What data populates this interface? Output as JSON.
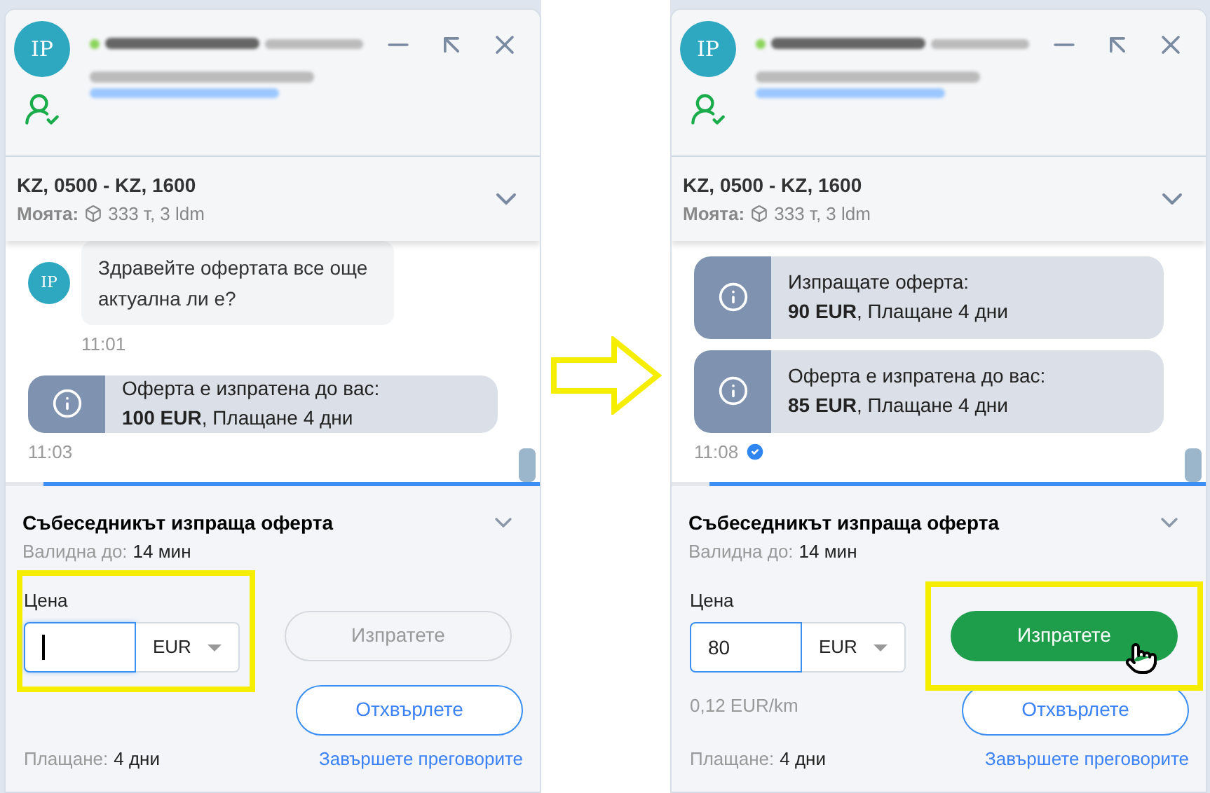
{
  "panels": [
    {
      "avatar": "IP",
      "route": "KZ, 0500 - KZ, 1600",
      "cargo_label": "Моята:",
      "cargo": "333 т, 3 ldm",
      "messages": [
        {
          "kind": "text",
          "avatar": "IP",
          "text": "Здравейте офертата все още актуална ли е?",
          "time": "11:01"
        },
        {
          "kind": "offer",
          "line1": "Оферта е изпратена до вас:",
          "line2": "**100 EUR**, Плащане 4 дни"
        },
        {
          "kind": "time",
          "text": "11:03",
          "read": false
        }
      ],
      "offer": {
        "timer": {
          "level": 0.93
        },
        "title": "Събеседникът изпраща оферта",
        "valid_label": "Валидна до:",
        "valid_value": "14 мин",
        "price_label": "Цена",
        "price": {
          "focused": true,
          "highlighted": true
        },
        "currency": "EUR",
        "send": {
          "label": "Изпратете",
          "enabled": false,
          "hovered": false,
          "highlighted": false
        },
        "reject": "Отхвърлете",
        "payment_label": "Плащане:",
        "payment_value": "4 дни",
        "end_link": "Завършете преговорите"
      }
    },
    {
      "avatar": "IP",
      "route": "KZ, 0500 - KZ, 1600",
      "cargo_label": "Моята:",
      "cargo": "333 т, 3 ldm",
      "messages": [
        {
          "kind": "offer",
          "line1": "Изпращате оферта:",
          "line2": "**90 EUR**, Плащане 4 дни"
        },
        {
          "kind": "offer",
          "line1": "Оферта е изпратена до вас:",
          "line2": "**85 EUR**, Плащане 4 дни"
        },
        {
          "kind": "time",
          "text": "11:08",
          "read": true
        }
      ],
      "offer": {
        "timer": {
          "level": 0.93
        },
        "title": "Събеседникът изпраща оферта",
        "valid_label": "Валидна до:",
        "valid_value": "14 мин",
        "price_label": "Цена",
        "price": {
          "focused": false,
          "value": "80",
          "highlighted": false
        },
        "per_km": "0,12 EUR/km",
        "currency": "EUR",
        "send": {
          "label": "Изпратете",
          "enabled": true,
          "hovered": true,
          "highlighted": true
        },
        "reject": "Отхвърлете",
        "payment_label": "Плащане:",
        "payment_value": "4 дни",
        "end_link": "Завършете преговорите"
      }
    }
  ]
}
